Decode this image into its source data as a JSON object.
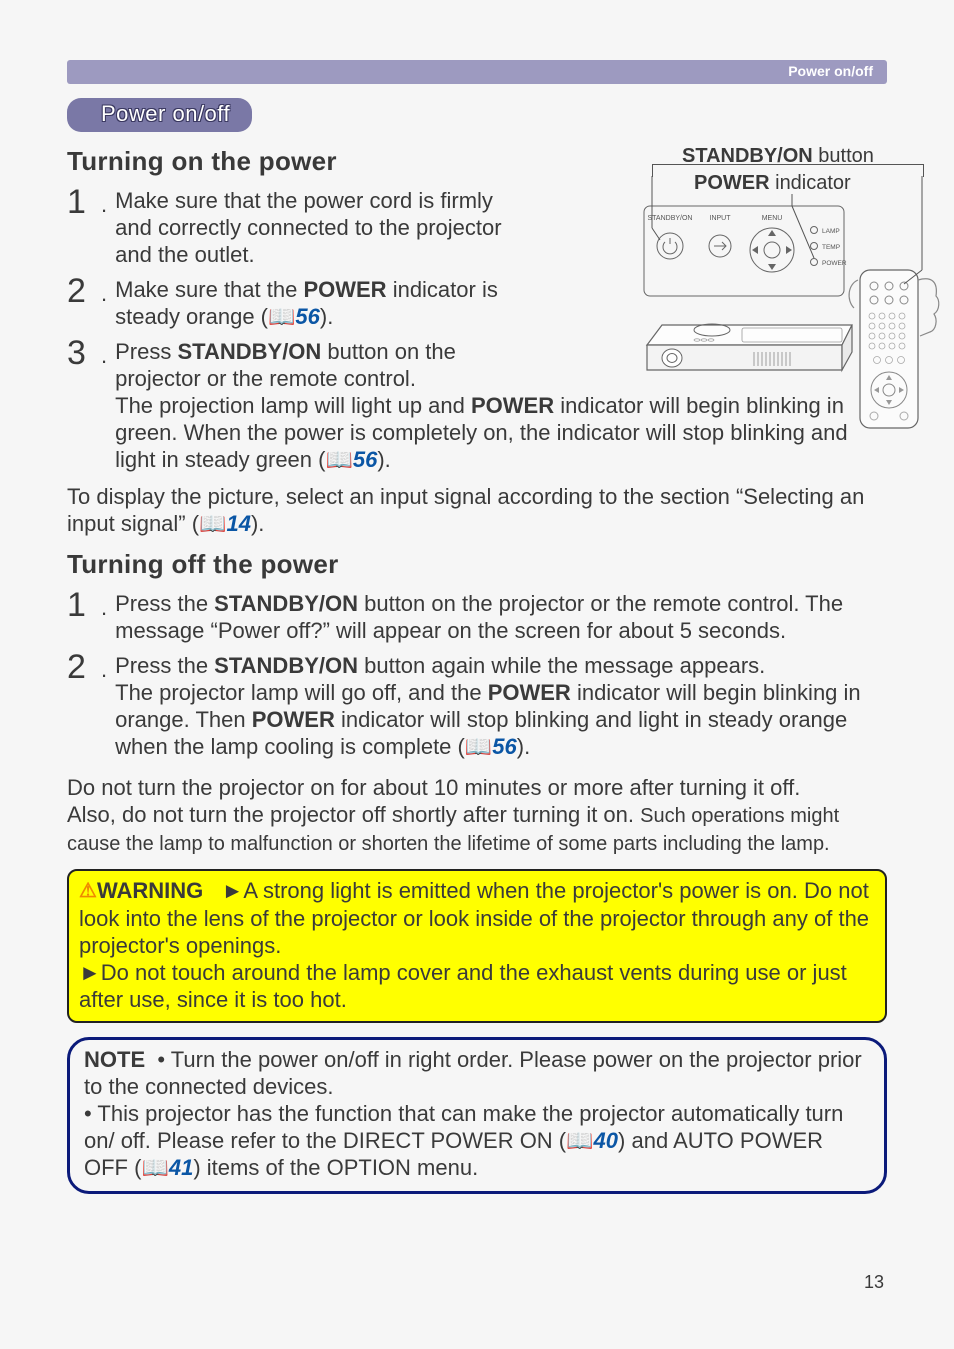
{
  "header": {
    "label": "Power on/off"
  },
  "pill": "Power on/off",
  "figure": {
    "label_standby": "STANDBY/ON",
    "label_standby_suffix": " button",
    "label_power": "POWER",
    "label_power_suffix": " indicator",
    "ind_lamp": "LAMP",
    "ind_temp": "TEMP",
    "ind_power": "POWER",
    "btn_standby": "STANDBY/ON",
    "btn_input": "INPUT",
    "btn_menu": "MENU"
  },
  "turning_on": {
    "heading": "Turning on the power",
    "steps": [
      {
        "n": "1",
        "text": "Make sure that the power cord is firmly and correctly connected to the projector and the outlet."
      },
      {
        "n": "2",
        "pre": "Make sure that the ",
        "b1": "POWER",
        "post": " indicator is steady orange (",
        "ref": "56",
        "tail": ")."
      },
      {
        "n": "3",
        "p1_pre": "Press ",
        "p1_b": "STANDBY/ON",
        "p1_post": " button on the projector or the remote control.",
        "p2_pre": "The projection lamp will light up and ",
        "p2_b": "POWER",
        "p2_post": " indicator will begin blinking in green. When the power is completely on, the indicator will stop blinking and light in steady green (",
        "p2_ref": "56",
        "p2_tail": ")."
      }
    ],
    "after_pre": "To display the picture, select an input signal according to the section “Selecting an input signal” (",
    "after_ref": "14",
    "after_tail": ")."
  },
  "turning_off": {
    "heading": "Turning off the power",
    "steps": [
      {
        "n": "1",
        "pre": "Press the ",
        "b": "STANDBY/ON",
        "post": " button on the projector or the remote control. The message “Power off?” will appear on the screen for about 5 seconds."
      },
      {
        "n": "2",
        "l1_pre": "Press the ",
        "l1_b": "STANDBY/ON",
        "l1_post": " button again while the message appears.",
        "l2_pre": "The projector lamp will go off, and the ",
        "l2_b1": "POWER",
        "l2_mid": " indicator will begin blinking in orange. Then ",
        "l2_b2": "POWER",
        "l2_post": " indicator will stop blinking and light in steady orange when the lamp cooling is complete (",
        "l2_ref": "56",
        "l2_tail": ")."
      }
    ],
    "after1": "Do not turn the projector on for about 10 minutes or more after turning it off.",
    "after2": "Also, do not turn the projector off shortly after turning it on. ",
    "after2_small": "Such operations might cause the lamp to malfunction or shorten the lifetime of some parts including the lamp."
  },
  "warning": {
    "lead": "WARNING",
    "arrow": "►",
    "p1": "A strong light is emitted when the projector's power is on. Do not look into the lens of the projector or look inside of the projector through any of the projector's openings.",
    "p2": "Do not touch around the lamp cover and the exhaust vents during use or just after use, since it is too hot."
  },
  "note": {
    "lead": "NOTE",
    "b1": "• Turn the power on/off in right order. Please power on the projector prior to the connected devices.",
    "b2_pre": "• This projector has the function that can make the projector automatically turn on/ off. Please refer to the DIRECT POWER ON (",
    "b2_ref1": "40",
    "b2_mid": ") and AUTO POWER OFF (",
    "b2_ref2": "41",
    "b2_tail": ") items of the OPTION menu."
  },
  "page_number": "13",
  "icon": "📖"
}
